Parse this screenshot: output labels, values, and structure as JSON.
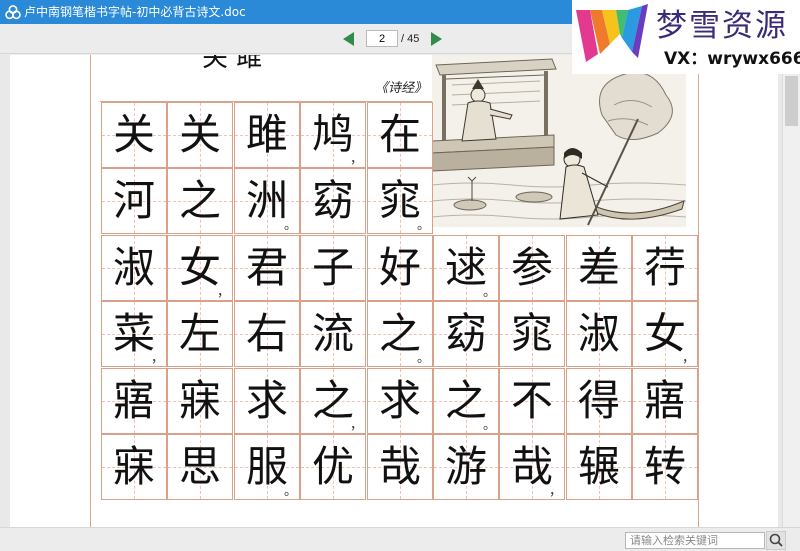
{
  "window": {
    "title": "卢中南钢笔楷书字帖-初中必背古诗文.doc"
  },
  "watermark": {
    "title": "梦雪资源",
    "subtitle": "VX：wrywx666"
  },
  "toolbar": {
    "page_current": "2",
    "page_total": "/ 45"
  },
  "document": {
    "poem_title": "关 雎",
    "source": "《诗经》",
    "rows": [
      [
        "关",
        "关",
        "雎",
        "鸠",
        "在"
      ],
      [
        "河",
        "之",
        "洲",
        "窈",
        "窕"
      ],
      [
        "淑",
        "女",
        "君",
        "子",
        "好",
        "逑",
        "参",
        "差",
        "荇"
      ],
      [
        "菜",
        "左",
        "右",
        "流",
        "之",
        "窈",
        "窕",
        "淑",
        "女"
      ],
      [
        "寤",
        "寐",
        "求",
        "之",
        "求",
        "之",
        "不",
        "得",
        "寤"
      ],
      [
        "寐",
        "思",
        "服",
        "优",
        "哉",
        "游",
        "哉",
        "辗",
        "转"
      ]
    ],
    "marks": {
      "0-3": "，",
      "1-4": "。",
      "1-2": "。",
      "2-1": "，",
      "2-5": "。",
      "3-0": "，",
      "3-4": "。",
      "3-8": "，",
      "4-3": "，",
      "4-5": "。",
      "5-2": "。",
      "5-6": "，"
    }
  },
  "search": {
    "placeholder": "请输入检索关键词"
  },
  "colors": {
    "titlebar": "#2a8ad8",
    "grid_line": "#d9a08a",
    "watermark_text": "#3a2a78"
  },
  "icons": {
    "app": "cloud-link-icon",
    "prev": "triangle-left-icon",
    "next": "triangle-right-icon",
    "search": "magnifier-icon"
  }
}
